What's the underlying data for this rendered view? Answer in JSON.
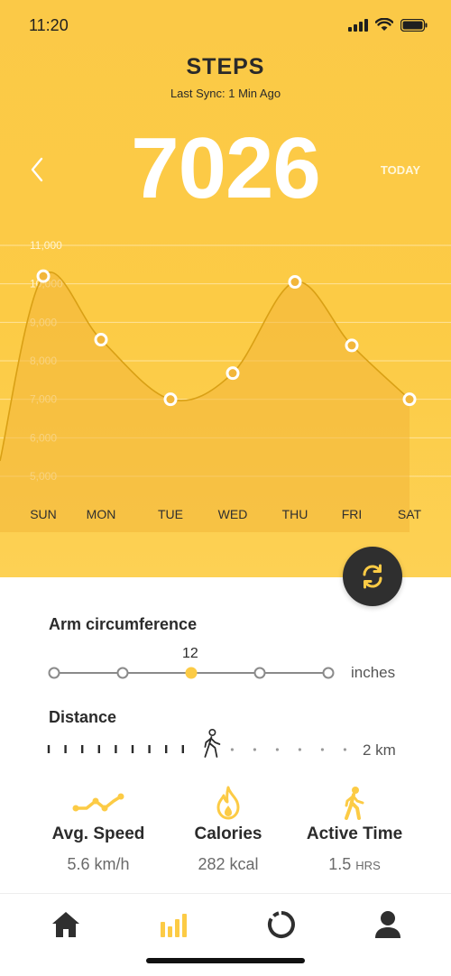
{
  "status_bar": {
    "time": "11:20"
  },
  "header": {
    "title": "STEPS",
    "subtitle": "Last Sync: 1 Min Ago",
    "step_count": "7026",
    "today_label": "TODAY"
  },
  "chart_data": {
    "type": "area",
    "categories": [
      "SUN",
      "MON",
      "TUE",
      "WED",
      "THU",
      "FRI",
      "SAT"
    ],
    "values": [
      10200,
      8550,
      7000,
      7680,
      10050,
      8400,
      7000
    ],
    "y_ticks": [
      "11,000",
      "10,000",
      "9,000",
      "8,000",
      "7,000",
      "6,000",
      "5,000"
    ],
    "ylim": [
      5000,
      11000
    ],
    "grid": true,
    "title": "",
    "xlabel": "",
    "ylabel": "",
    "colors": {
      "line": "#d9a015",
      "fill": "#f2b63a",
      "marker": "#ffffff"
    }
  },
  "arm": {
    "title": "Arm circumference",
    "value": "12",
    "unit": "inches",
    "stops": 5,
    "selected_index": 2
  },
  "distance": {
    "title": "Distance",
    "value": "2 km",
    "progress": 0.55
  },
  "stats": {
    "speed": {
      "label": "Avg. Speed",
      "value": "5.6 km/h",
      "icon": "trend-line-icon"
    },
    "calories": {
      "label": "Calories",
      "value": "282 kcal",
      "icon": "flame-icon"
    },
    "active": {
      "label": "Active Time",
      "value": "1.5",
      "unit": "HRS",
      "icon": "walking-icon"
    }
  },
  "tabs": [
    {
      "name": "home",
      "icon": "home-icon",
      "active": false
    },
    {
      "name": "stats",
      "icon": "bar-chart-icon",
      "active": true
    },
    {
      "name": "progress",
      "icon": "progress-ring-icon",
      "active": false
    },
    {
      "name": "profile",
      "icon": "user-icon",
      "active": false
    }
  ],
  "colors": {
    "accent": "#fccb45",
    "dark": "#2f2f2f",
    "text": "#2b2b2b"
  }
}
